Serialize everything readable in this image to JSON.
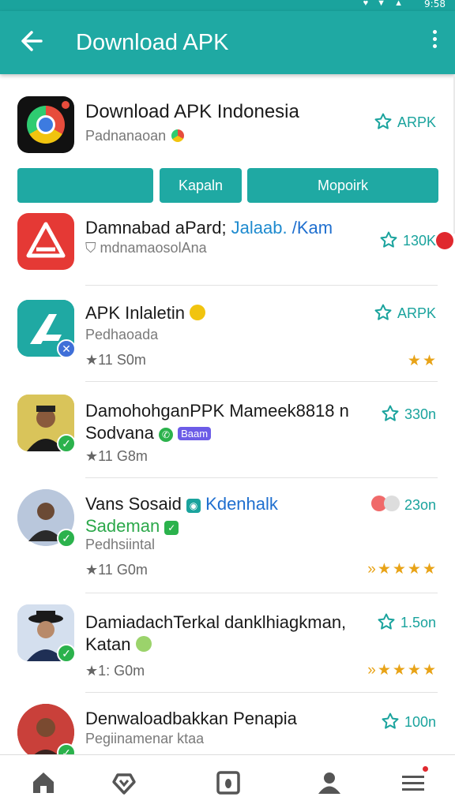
{
  "status_bar": {
    "time": "9:58",
    "icons": "♥ ▼ ▲"
  },
  "app_bar": {
    "title": "Download APK"
  },
  "header": {
    "title": "Download APK Indonesia",
    "subtitle": "Padnanaoan",
    "badge": "ARPK"
  },
  "buttons": [
    {
      "label": ""
    },
    {
      "label": "Kapaln"
    },
    {
      "label": "Mopoirk"
    }
  ],
  "apps": [
    {
      "title_main": "Damnabad aPard; ",
      "title_link": "Jalaab. ",
      "title_link2": "/Kam",
      "subtitle": "mdnamaosolAna",
      "right": "130K"
    },
    {
      "title": "APK Inlaletin",
      "subtitle": "Pedhaoada",
      "meta": "★11 S0m",
      "right": "ARPK"
    },
    {
      "title": "DamohohganPPK Mameek8818 n",
      "title2": "Sodvana",
      "pill": "Baam",
      "meta": "★11 G8m",
      "right": "330n"
    },
    {
      "title": "Vans Sosaid",
      "title_link": "Kdenhalk",
      "sub_green": "Sademan",
      "subtitle": "Pedhsiintal",
      "meta": "★11 G0m",
      "right": "23on"
    },
    {
      "title": "DamiadachTerkal danklhiagkman,",
      "title2": "Katan",
      "meta": "★1: G0m",
      "right": "1.5on"
    },
    {
      "title": "Denwaloadbakkan Penapia",
      "subtitle": "Pegiinamenar ktaa",
      "right": "100n"
    }
  ],
  "icon_colors": {
    "accent": "#1fa9a3",
    "star": "#e8a317",
    "verified": "#2bb24c",
    "alert": "#e0282e"
  },
  "nav": {
    "items": [
      "home-icon",
      "shield-icon",
      "store-icon",
      "profile-icon",
      "menu-icon"
    ]
  }
}
